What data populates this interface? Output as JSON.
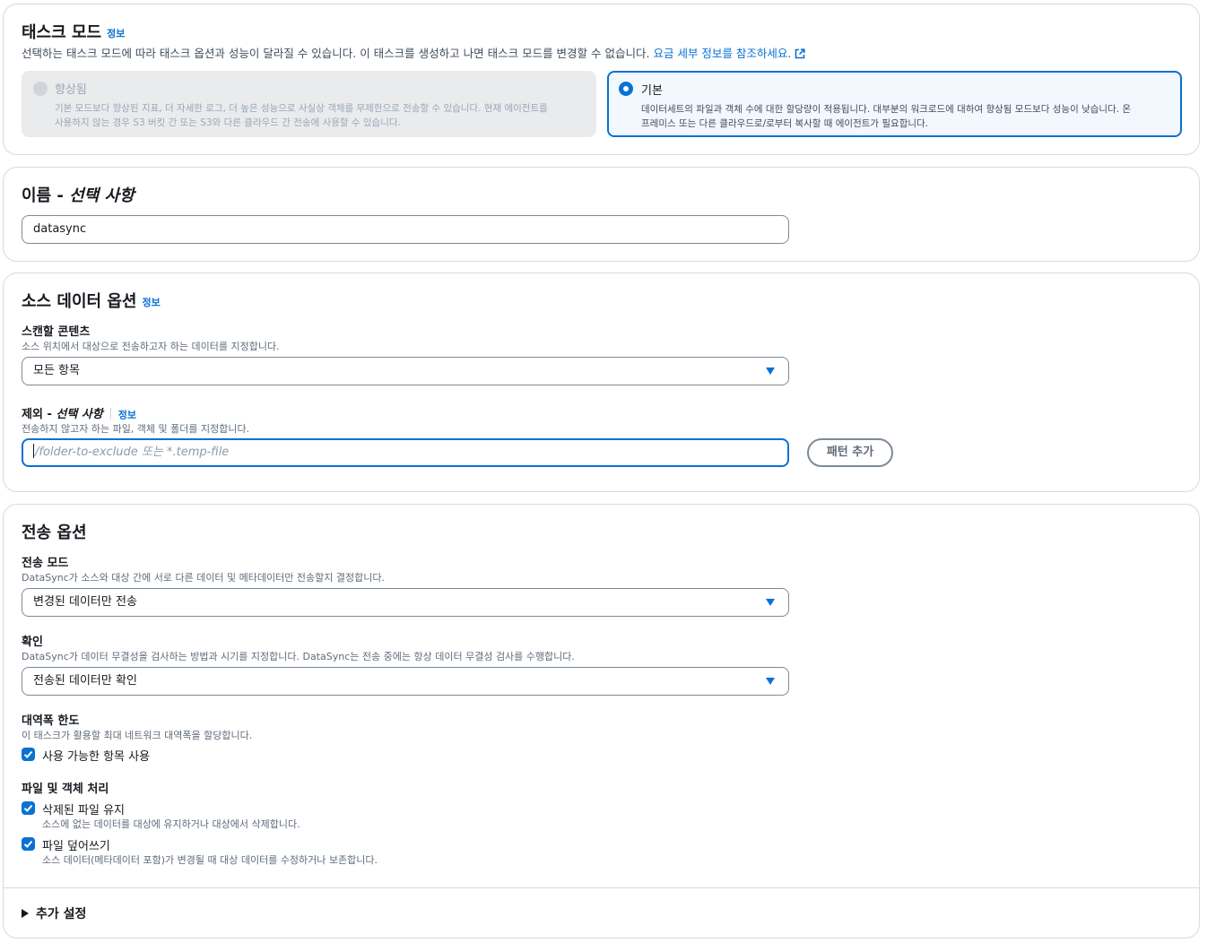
{
  "task_mode": {
    "title": "태스크 모드",
    "info": "정보",
    "description": "선택하는 태스크 모드에 따라 태스크 옵션과 성능이 달라질 수 있습니다. 이 태스크를 생성하고 나면 태스크 모드를 변경할 수 없습니다.",
    "pricing_link": "요금 세부 정보를 참조하세요.",
    "options": [
      {
        "label": "향상됨",
        "description_line1": "기본 모드보다 향상된 지표, 더 자세한 로그, 더 높은 성능으로 사실상 객체를 무제한으로 전송할 수 있습니다. 현재 에이전트를",
        "description_line2": "사용하지 않는 경우 S3 버킷 간 또는 S3와 다른 클라우드 간 전송에 사용할 수 있습니다.",
        "state": "disabled"
      },
      {
        "label": "기본",
        "description_line1": "데이터세트의 파일과 객체 수에 대한 할당량이 적용됩니다. 대부분의 워크로드에 대하여 향상됨 모드보다 성능이 낮습니다. 온",
        "description_line2": "프레미스 또는 다른 클라우드로/로부터 복사할 때 에이전트가 필요합니다.",
        "state": "selected"
      }
    ]
  },
  "name_section": {
    "title_main": "이름 - ",
    "title_optional": "선택 사항",
    "value": "datasync"
  },
  "source_options": {
    "title": "소스 데이터 옵션",
    "info": "정보",
    "scan_label": "스캔할 콘텐츠",
    "scan_desc": "소스 위치에서 대상으로 전송하고자 하는 데이터를 지정합니다.",
    "scan_value": "모든 항목",
    "exclude_label_main": "제외 - ",
    "exclude_label_optional": "선택 사항",
    "exclude_info": "정보",
    "exclude_desc": "전송하지 않고자 하는 파일, 객체 및 폴더를 지정합니다.",
    "exclude_placeholder": "/folder-to-exclude 또는 *.temp-file",
    "add_pattern": "패턴 추가"
  },
  "transfer_options": {
    "title": "전송 옵션",
    "mode_label": "전송 모드",
    "mode_desc": "DataSync가 소스와 대상 간에 서로 다른 데이터 및 메타데이터만 전송할지 결정합니다.",
    "mode_value": "변경된 데이터만 전송",
    "verify_label": "확인",
    "verify_desc": "DataSync가 데이터 무결성을 검사하는 방법과 시기를 지정합니다. DataSync는 전송 중에는 항상 데이터 무결성 검사를 수행합니다.",
    "verify_value": "전송된 데이터만 확인",
    "bandwidth_label": "대역폭 한도",
    "bandwidth_desc": "이 태스크가 활용할 최대 네트워크 대역폭을 할당합니다.",
    "bandwidth_checkbox": "사용 가능한 항목 사용",
    "file_handling_label": "파일 및 객체 처리",
    "keep_deleted": "삭제된 파일 유지",
    "keep_deleted_desc": "소스에 없는 데이터를 대상에 유지하거나 대상에서 삭제합니다.",
    "overwrite": "파일 덮어쓰기",
    "overwrite_desc": "소스 데이터(메타데이터 포함)가 변경될 때 대상 데이터를 수정하거나 보존합니다.",
    "additional_settings": "추가 설정"
  },
  "colors": {
    "accent": "#0972d3",
    "border": "#d5dbdb",
    "text": "#16191f"
  }
}
